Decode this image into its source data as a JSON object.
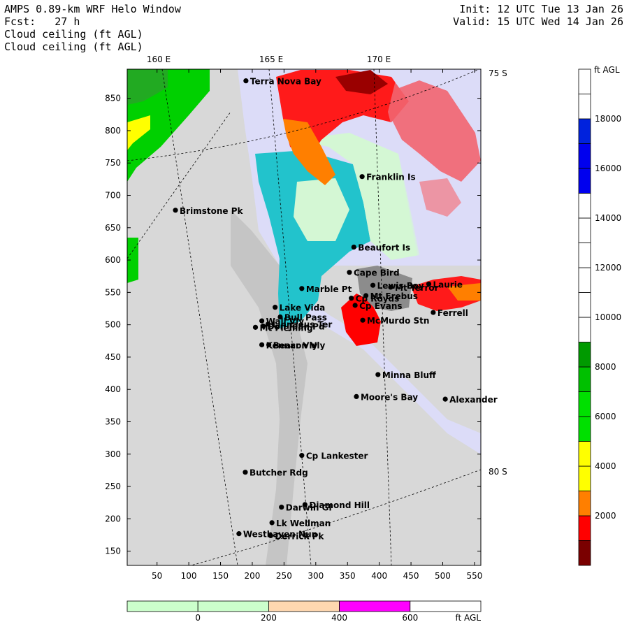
{
  "header": {
    "model": "AMPS 0.89-km WRF Helo Window",
    "fcst": "Fcst:   27 h",
    "field1": "Cloud ceiling (ft AGL)",
    "field2": "Cloud ceiling (ft AGL)",
    "init": "Init: 12 UTC Tue 13 Jan 26",
    "valid": "Valid: 15 UTC Wed 14 Jan 26"
  },
  "map": {
    "lon_labels": [
      "160 E",
      "165 E",
      "170 E"
    ],
    "lat_labels": [
      "75 S",
      "80 S"
    ],
    "x_ticks": [
      "50",
      "100",
      "150",
      "200",
      "250",
      "300",
      "350",
      "400",
      "450",
      "500",
      "550"
    ],
    "y_ticks": [
      "850",
      "800",
      "750",
      "700",
      "650",
      "600",
      "550",
      "500",
      "450",
      "400",
      "350",
      "300",
      "250",
      "200",
      "150"
    ],
    "places": [
      {
        "name": "Terra Nova Bay",
        "x": 190,
        "y": 877,
        "dot": true
      },
      {
        "name": "Franklin Is",
        "x": 373,
        "y": 729,
        "dot": true
      },
      {
        "name": "Brimstone Pk",
        "x": 79,
        "y": 677,
        "dot": true
      },
      {
        "name": "Beaufort Is",
        "x": 360,
        "y": 620,
        "dot": true
      },
      {
        "name": "Cape Bird",
        "x": 353,
        "y": 581,
        "dot": true
      },
      {
        "name": "Lewis Bay",
        "x": 390,
        "y": 561,
        "dot": true
      },
      {
        "name": "Laurie",
        "x": 478,
        "y": 563,
        "dot": true
      },
      {
        "name": "Mt Terror",
        "x": 418,
        "y": 558,
        "dot": true
      },
      {
        "name": "Marble Pt",
        "x": 278,
        "y": 556,
        "dot": true
      },
      {
        "name": "Cp Royds",
        "x": 356,
        "y": 541,
        "dot": true
      },
      {
        "name": "Mt Erebus",
        "x": 379,
        "y": 545,
        "dot": true
      },
      {
        "name": "Lake Vida",
        "x": 236,
        "y": 527,
        "dot": true
      },
      {
        "name": "Cp Evans",
        "x": 362,
        "y": 530,
        "dot": true
      },
      {
        "name": "Ferrell",
        "x": 485,
        "y": 519,
        "dot": true
      },
      {
        "name": "Wall Vly",
        "x": 215,
        "y": 506,
        "dot": true
      },
      {
        "name": "Bull Pass",
        "x": 244,
        "y": 512,
        "dot": true
      },
      {
        "name": "McMurdo Stn",
        "x": 374,
        "y": 507,
        "dot": true
      },
      {
        "name": "Don Juan Pd",
        "x": 217,
        "y": 498,
        "dot": true
      },
      {
        "name": "Mt Fleming",
        "x": 205,
        "y": 496,
        "dot": true
      },
      {
        "name": "Linnaeus Ter",
        "x": 225,
        "y": 501,
        "dot": true
      },
      {
        "name": "Kennar Vly",
        "x": 215,
        "y": 469,
        "dot": true
      },
      {
        "name": "Beacon Vly",
        "x": 226,
        "y": 469,
        "dot": true
      },
      {
        "name": "Minna Bluff",
        "x": 398,
        "y": 423,
        "dot": true
      },
      {
        "name": "Moore's Bay",
        "x": 364,
        "y": 389,
        "dot": true
      },
      {
        "name": "Alexander",
        "x": 504,
        "y": 385,
        "dot": true
      },
      {
        "name": "Cp Lankester",
        "x": 278,
        "y": 298,
        "dot": true
      },
      {
        "name": "Butcher Rdg",
        "x": 189,
        "y": 272,
        "dot": true
      },
      {
        "name": "Darwin Gl",
        "x": 246,
        "y": 218,
        "dot": true
      },
      {
        "name": "Diamond Hill",
        "x": 283,
        "y": 222,
        "dot": true
      },
      {
        "name": "Lk Wellman",
        "x": 231,
        "y": 194,
        "dot": true
      },
      {
        "name": "Westhaven Nun",
        "x": 179,
        "y": 177,
        "dot": true
      },
      {
        "name": "Derrick Pk",
        "x": 229,
        "y": 174,
        "dot": true
      }
    ]
  },
  "colorbar_right": {
    "unit": "ft AGL",
    "labels": [
      "18000",
      "16000",
      "14000",
      "12000",
      "10000",
      "8000",
      "6000",
      "4000",
      "2000"
    ],
    "colors": [
      "#7a0000",
      "#ff0000",
      "#ff7f00",
      "#ffff00",
      "#ffff00",
      "#00e000",
      "#00e000",
      "#00c000",
      "#009a00",
      "#ffffff",
      "#ffffff",
      "#ffffff",
      "#ffffff",
      "#ffffff",
      "#ffffff",
      "#0000ee",
      "#0000ee",
      "#0022dd",
      "#ffffff",
      "#ffffff"
    ]
  },
  "colorbar_bottom": {
    "unit": "ft AGL",
    "labels": [
      "0",
      "200",
      "400",
      "600"
    ],
    "colors": [
      "#ccffcc",
      "#ccffcc",
      "#ffd8b0",
      "#ff00ff",
      "#ffffff"
    ]
  },
  "palette": {
    "land_gray": "#d4d4d4",
    "ice_lavender": "#dcdcf8",
    "low_cloud_cyan": "#22c3cc",
    "pale_green": "#d4f7d4",
    "red": "#ff0000",
    "orange": "#ff7f00",
    "green": "#00d000",
    "yellow": "#ffff00"
  }
}
